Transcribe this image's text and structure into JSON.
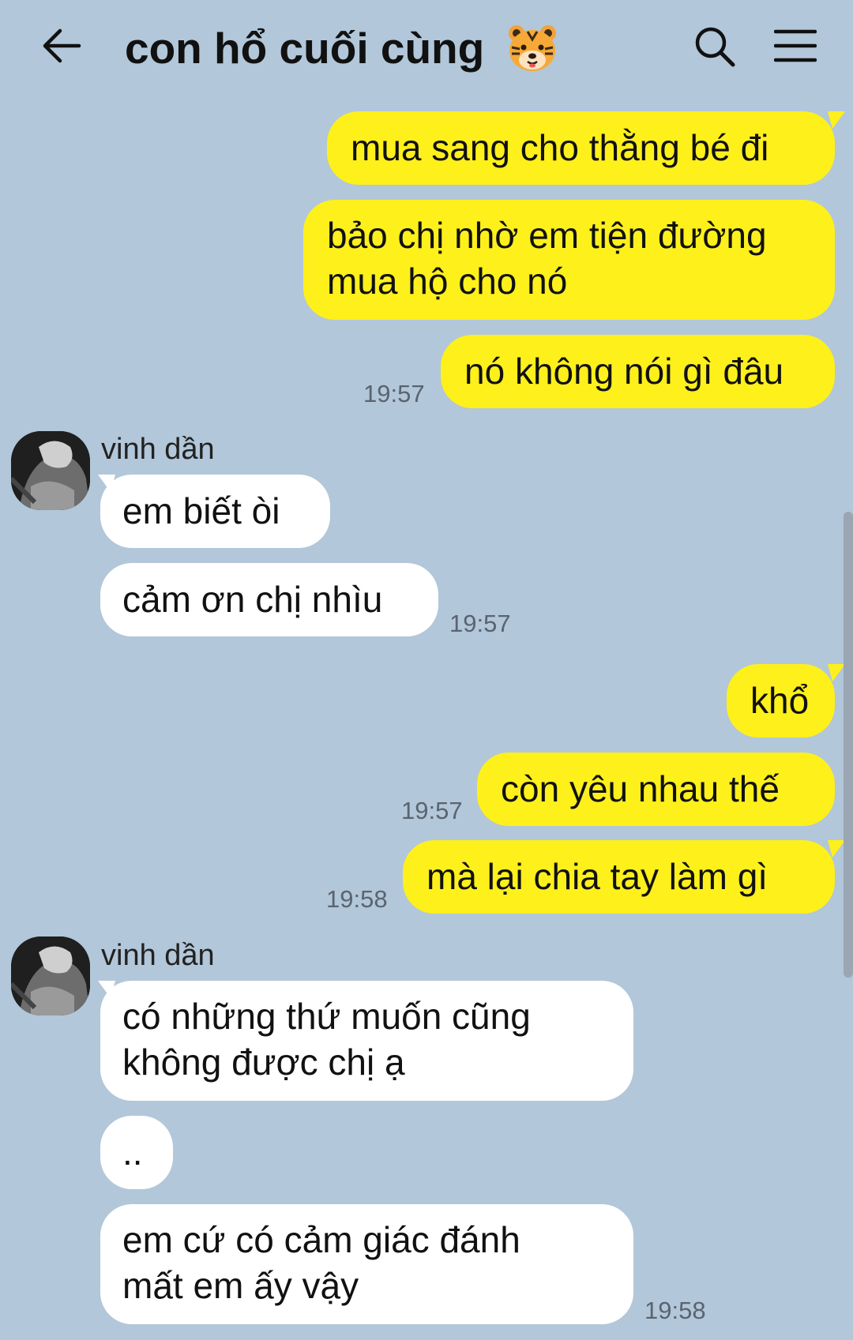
{
  "header": {
    "title": "con hổ cuối cùng",
    "back_icon": "arrow-left-icon",
    "title_emoji_icon": "tiger-face-icon",
    "search_icon": "search-icon",
    "menu_icon": "hamburger-menu-icon"
  },
  "colors": {
    "background": "#B2C7D9",
    "my_bubble": "#FEF01B",
    "their_bubble": "#FFFFFF"
  },
  "messages": [
    {
      "from": "me",
      "lines": [
        "mua sang cho thằng bé đi"
      ]
    },
    {
      "from": "me",
      "lines": [
        "bảo chị nhờ em tiện đường",
        "mua hộ cho nó"
      ]
    },
    {
      "from": "me",
      "lines": [
        "nó không nói gì đâu"
      ],
      "time": "19:57"
    },
    {
      "from": "vinh dần",
      "lines": [
        "em biết òi"
      ]
    },
    {
      "from": "vinh dần",
      "lines": [
        "cảm ơn chị nhìu"
      ],
      "time": "19:57"
    },
    {
      "from": "me",
      "lines": [
        "khổ"
      ]
    },
    {
      "from": "me",
      "lines": [
        "còn yêu nhau thế"
      ],
      "time": "19:57"
    },
    {
      "from": "me",
      "lines": [
        "mà lại chia tay làm gì"
      ],
      "time": "19:58"
    },
    {
      "from": "vinh dần",
      "lines": [
        "có những thứ muốn cũng",
        "không được chị ạ"
      ]
    },
    {
      "from": "vinh dần",
      "lines": [
        ".."
      ]
    },
    {
      "from": "vinh dần",
      "lines": [
        "em cứ có cảm giác đánh",
        "mất em ấy vậy"
      ],
      "time": "19:58"
    }
  ],
  "senders": [
    {
      "name": "vinh dần"
    },
    {
      "name": "vinh dần"
    }
  ]
}
